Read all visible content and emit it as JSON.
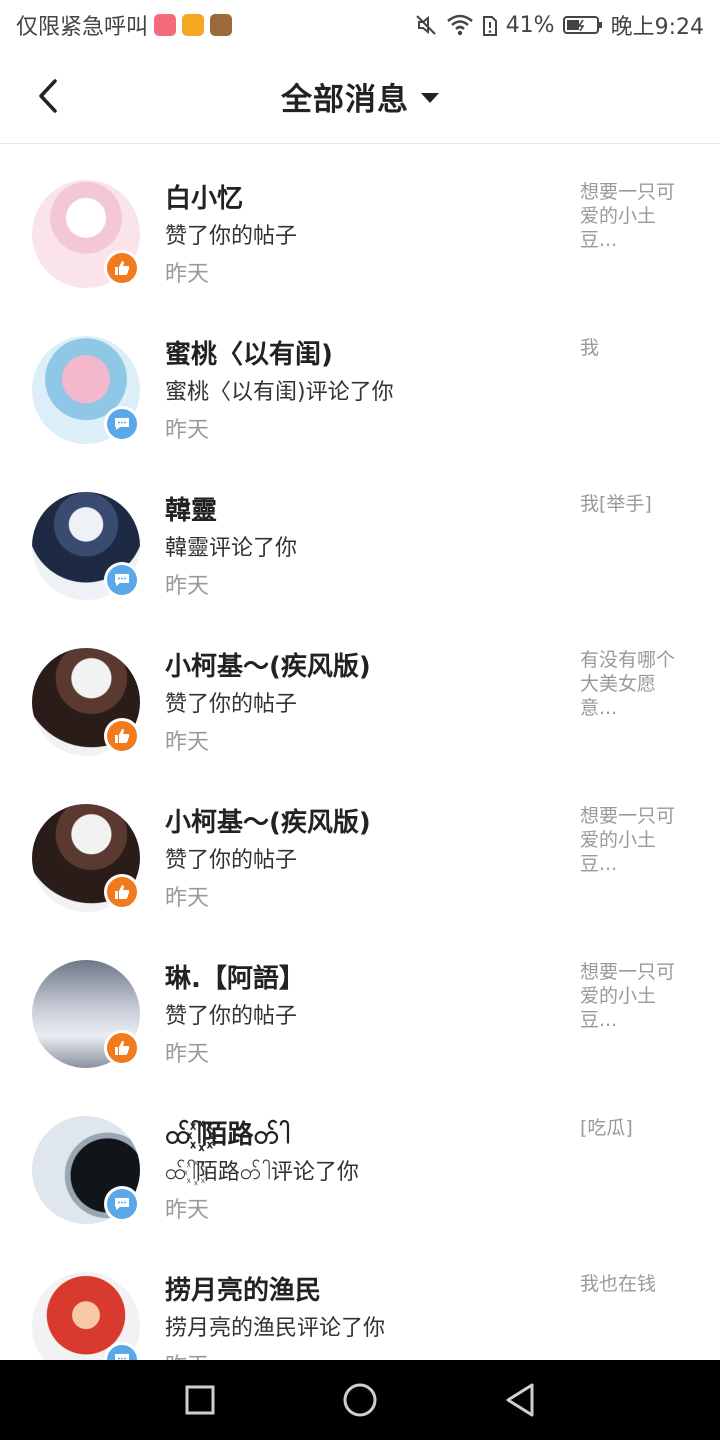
{
  "status_bar": {
    "carrier": "仅限紧急呼叫",
    "battery": "41%",
    "time": "晚上9:24",
    "app_icons": [
      {
        "name": "gift-app-icon",
        "color": "#f46b7e"
      },
      {
        "name": "calendar-app-icon",
        "color": "#f5a623"
      },
      {
        "name": "game-app-icon",
        "color": "#9a6a3a"
      }
    ]
  },
  "header": {
    "title": "全部消息",
    "back_icon": "back-arrow-icon",
    "dropdown_icon": "caret-down-icon"
  },
  "messages": [
    {
      "name": "白小忆",
      "action": "赞了你的帖子",
      "time": "昨天",
      "snippet": "想要一只可爱的小土豆...",
      "type": "like",
      "avatar_colors": [
        "#fbe3ea",
        "#f3c8d4",
        "#ffffff"
      ]
    },
    {
      "name": "蜜桃〈以有闺)",
      "action": "蜜桃〈以有闺)评论了你",
      "time": "昨天",
      "snippet": "我",
      "type": "comment",
      "avatar_colors": [
        "#dceff8",
        "#f4b8cc",
        "#8fc7e6"
      ]
    },
    {
      "name": "韓靈",
      "action": "韓靈评论了你",
      "time": "昨天",
      "snippet": "我[举手]",
      "type": "comment",
      "avatar_colors": [
        "#eef1f6",
        "#1e2a44",
        "#3a4b70"
      ]
    },
    {
      "name": "小柯基～(疾风版)",
      "action": "赞了你的帖子",
      "time": "昨天",
      "snippet": "有没有哪个大美女愿意...",
      "type": "like",
      "avatar_colors": [
        "#f2f2f2",
        "#2a1c18",
        "#5a3a30"
      ]
    },
    {
      "name": "小柯基～(疾风版)",
      "action": "赞了你的帖子",
      "time": "昨天",
      "snippet": "想要一只可爱的小土豆...",
      "type": "like",
      "avatar_colors": [
        "#f2f2f2",
        "#2a1c18",
        "#5a3a30"
      ]
    },
    {
      "name": "琳.【阿語】",
      "action": "赞了你的帖子",
      "time": "昨天",
      "snippet": "想要一只可爱的小土豆...",
      "type": "like",
      "avatar_colors": [
        "#c7ccd6",
        "#e9edf2",
        "#6f7788"
      ]
    },
    {
      "name": "ထ်ါ꙰陌路တ်ါ",
      "action": "ထ်ါ꙰陌路တ်ါ评论了你",
      "time": "昨天",
      "snippet": "[吃瓜]",
      "type": "comment",
      "avatar_colors": [
        "#dfe6ee",
        "#111418",
        "#9aa6b4"
      ]
    },
    {
      "name": "捞月亮的渔民",
      "action": "捞月亮的渔民评论了你",
      "time": "昨天",
      "snippet": "我也在钱",
      "type": "comment",
      "avatar_colors": [
        "#f2f2f4",
        "#d83a2e",
        "#f6c8a6"
      ]
    }
  ],
  "nav_bar": {
    "recent_icon": "square-recent-icon",
    "home_icon": "circle-home-icon",
    "back_icon": "triangle-back-icon"
  }
}
